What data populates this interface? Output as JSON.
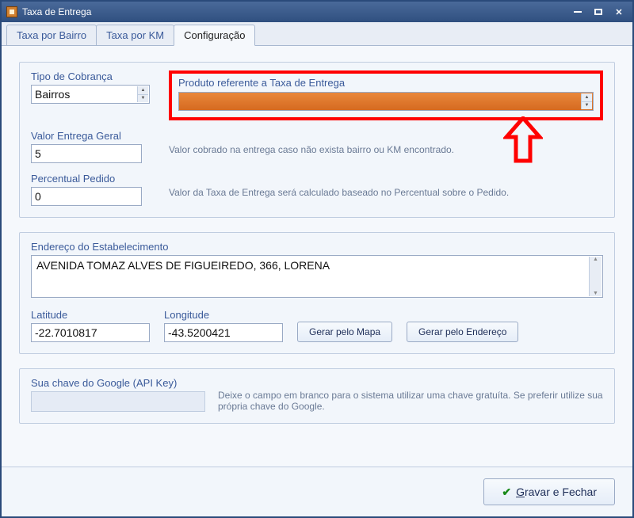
{
  "window": {
    "title": "Taxa de Entrega"
  },
  "tabs": {
    "bairro": "Taxa por Bairro",
    "km": "Taxa por KM",
    "config": "Configuração"
  },
  "config": {
    "tipo_cobranca_label": "Tipo de Cobrança",
    "tipo_cobranca_value": "Bairros",
    "produto_label": "Produto referente a Taxa de Entrega",
    "produto_value": "",
    "valor_entrega_label": "Valor Entrega Geral",
    "valor_entrega_value": "5",
    "valor_entrega_hint": "Valor cobrado na entrega caso não exista bairro ou KM encontrado.",
    "percentual_label": "Percentual Pedido",
    "percentual_value": "0",
    "percentual_hint": "Valor da Taxa de Entrega será calculado baseado no Percentual sobre o Pedido.",
    "endereco_label": "Endereço do Estabelecimento",
    "endereco_value": "AVENIDA TOMAZ ALVES DE FIGUEIREDO, 366, LORENA",
    "latitude_label": "Latitude",
    "latitude_value": "-22.7010817",
    "longitude_label": "Longitude",
    "longitude_value": "-43.5200421",
    "btn_gerar_mapa": "Gerar pelo Mapa",
    "btn_gerar_endereco": "Gerar pelo Endereço",
    "api_label": "Sua chave do Google (API Key)",
    "api_hint": "Deixe o campo em branco para o sistema utilizar uma chave gratuíta. Se preferir utilize sua própria chave do Google."
  },
  "footer": {
    "save_prefix": "G",
    "save_rest": "ravar e Fechar"
  }
}
